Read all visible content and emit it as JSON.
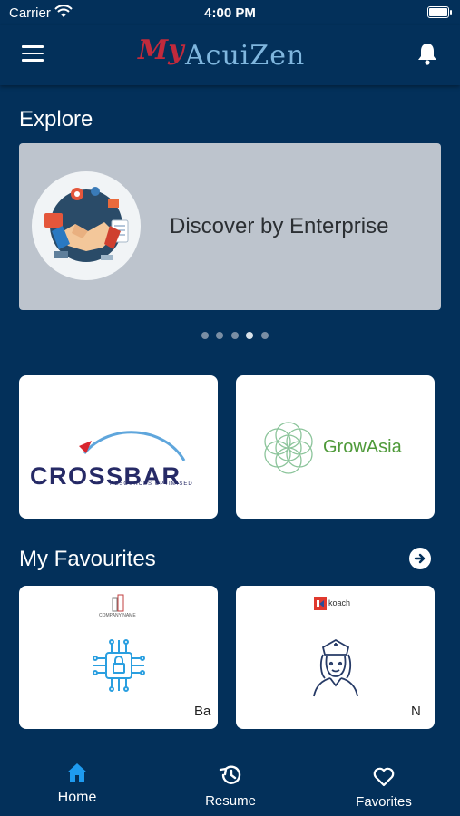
{
  "status_bar": {
    "carrier": "Carrier",
    "time": "4:00 PM"
  },
  "header": {
    "logo_script": "My",
    "logo_name": "AcuiZen",
    "icons": {
      "menu": "hamburger-icon",
      "notifications": "bell-icon"
    }
  },
  "explore": {
    "title": "Explore",
    "banner_text": "Discover by Enterprise",
    "carousel_dots": 5,
    "active_dot_index": 3
  },
  "enterprises": [
    {
      "name": "CROSSBAR",
      "tagline": "RESOURCES OPTIMISED"
    },
    {
      "name": "GrowAsia"
    }
  ],
  "favourites": {
    "title": "My Favourites",
    "items": [
      {
        "brand_caption": "COMPANY NAME",
        "icon": "chip-lock-icon",
        "title_cut": "Ba"
      },
      {
        "brand_caption": "koach",
        "icon": "nurse-icon",
        "title_cut": "N"
      }
    ]
  },
  "tabbar": {
    "tabs": [
      {
        "label": "Home",
        "icon": "home-icon",
        "active": true
      },
      {
        "label": "Resume",
        "icon": "history-icon",
        "active": false
      },
      {
        "label": "Favorites",
        "icon": "heart-icon",
        "active": false
      }
    ],
    "active_color": "#1e9bf0"
  }
}
